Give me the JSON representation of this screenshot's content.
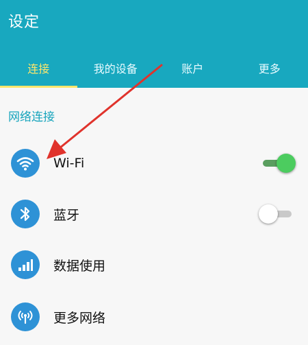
{
  "header": {
    "title": "设定"
  },
  "tabs": [
    {
      "label": "连接",
      "active": true
    },
    {
      "label": "我的设备",
      "active": false
    },
    {
      "label": "账户",
      "active": false
    },
    {
      "label": "更多",
      "active": false
    }
  ],
  "section": {
    "title": "网络连接"
  },
  "items": [
    {
      "label": "Wi-Fi",
      "icon": "wifi-icon",
      "toggle": "on"
    },
    {
      "label": "蓝牙",
      "icon": "bluetooth-icon",
      "toggle": "off"
    },
    {
      "label": "数据使用",
      "icon": "data-usage-icon"
    },
    {
      "label": "更多网络",
      "icon": "more-networks-icon"
    }
  ],
  "colors": {
    "header": "#18a8bf",
    "active_tab": "#ffe76b",
    "section_title": "#16a4bc",
    "icon_circle": "#2e92d6",
    "toggle_on": "#4ccc5f",
    "annotation_arrow": "#e0332c"
  }
}
